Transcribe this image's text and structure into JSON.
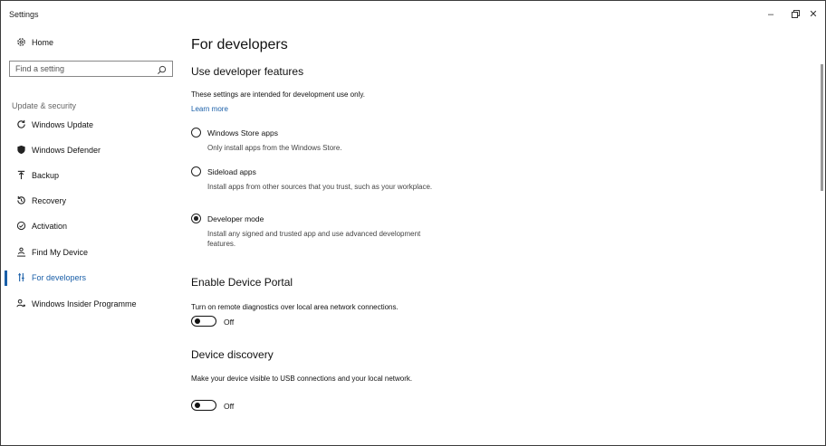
{
  "window": {
    "title": "Settings",
    "controls": {
      "minimize": "–",
      "maximize": "",
      "close": "✕"
    }
  },
  "sidebar": {
    "home": {
      "label": "Home",
      "icon": "gear-icon"
    },
    "search": {
      "placeholder": "Find a setting",
      "icon": "search-icon"
    },
    "section": "Update & security",
    "items": [
      {
        "label": "Windows Update",
        "icon": "refresh-icon"
      },
      {
        "label": "Windows Defender",
        "icon": "shield-icon"
      },
      {
        "label": "Backup",
        "icon": "backup-arrow-icon"
      },
      {
        "label": "Recovery",
        "icon": "history-icon"
      },
      {
        "label": "Activation",
        "icon": "check-circle-icon"
      },
      {
        "label": "Find My Device",
        "icon": "person-location-icon"
      },
      {
        "label": "For developers",
        "icon": "developer-sliders-icon",
        "active": true
      },
      {
        "label": "Windows Insider Programme",
        "icon": "insider-person-icon"
      }
    ]
  },
  "main": {
    "title": "For developers",
    "developer_features": {
      "heading": "Use developer features",
      "intro": "These settings are intended for development use only.",
      "learn_more": "Learn more",
      "options": [
        {
          "label": "Windows Store apps",
          "description": "Only install apps from the Windows Store.",
          "selected": false
        },
        {
          "label": "Sideload apps",
          "description": "Install apps from other sources that you trust, such as your workplace.",
          "selected": false
        },
        {
          "label": "Developer mode",
          "description": "Install any signed and trusted app and use advanced development features.",
          "selected": true
        }
      ]
    },
    "device_portal": {
      "heading": "Enable Device Portal",
      "description": "Turn on remote diagnostics over local area network connections.",
      "toggle_label": "Off"
    },
    "device_discovery": {
      "heading": "Device discovery",
      "description": "Make your device visible to USB connections and your local network.",
      "toggle_label": "Off"
    }
  },
  "colors": {
    "accent": "#1a5fa8",
    "text": "#111111",
    "muted": "#666666"
  }
}
